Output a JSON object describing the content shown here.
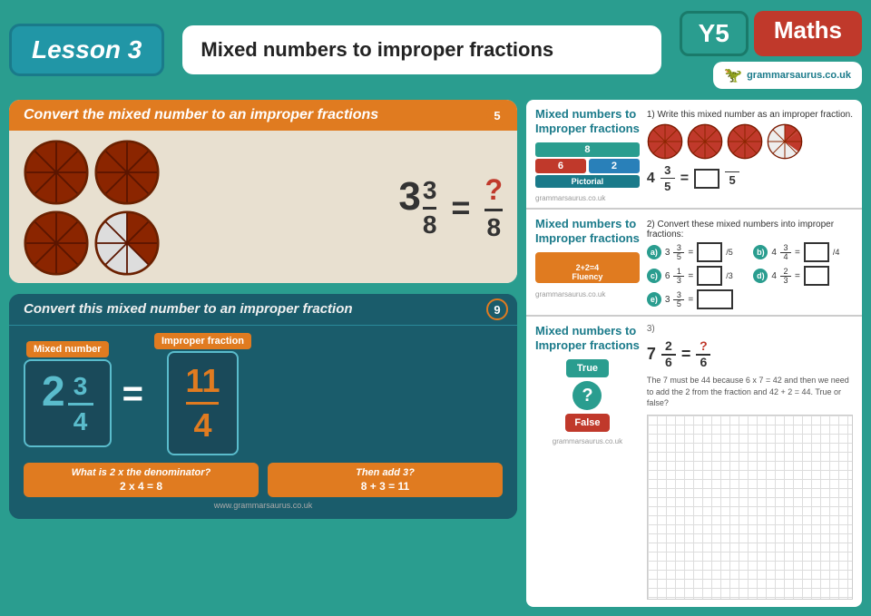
{
  "header": {
    "lesson_label": "Lesson 3",
    "title": "Mixed numbers to improper fractions",
    "year": "Y5",
    "subject": "Maths",
    "branding": "grammarsaurus.co.uk"
  },
  "slide1": {
    "number": "5",
    "header": "Convert the mixed number to an improper fractions",
    "mixed_number": "3",
    "frac_numerator": "3",
    "frac_denominator": "8",
    "equals": "=",
    "answer_numerator": "?",
    "answer_denominator": "8"
  },
  "slide2": {
    "number": "9",
    "header": "Convert this mixed number to an improper fraction",
    "mixed_label": "Mixed number",
    "mixed_whole": "2",
    "mixed_num": "3",
    "mixed_den": "4",
    "equals": "=",
    "improper_label": "Improper fraction",
    "improper_num": "11",
    "improper_den": "4",
    "hint1_question": "What is 2 x the denominator?",
    "hint1_answer": "2 x 4 = 8",
    "hint2_question": "Then add 3?",
    "hint2_answer": "8 + 3 = 11",
    "branding": "www.grammarsaurus.co.uk"
  },
  "worksheet": {
    "section1": {
      "title": "Mixed numbers to\nImproper fractions",
      "instruction": "1) Write this mixed number as an improper fraction.",
      "mixed_whole": "4",
      "mixed_num": "3",
      "mixed_den": "5",
      "equals": "=",
      "answer_den": "5",
      "pictorial_label": "Pictorial",
      "branding": "grammarsaurus.co.uk"
    },
    "section2": {
      "title": "Mixed numbers to\nImproper fractions",
      "instruction": "2) Convert these mixed numbers into improper fractions:",
      "items": [
        {
          "label": "a)",
          "expr": "3 3/5 = __/5"
        },
        {
          "label": "b)",
          "expr": "4 3/4 = __/4"
        },
        {
          "label": "c)",
          "expr": "6 1/3 = __/3"
        },
        {
          "label": "d)",
          "expr": "4 2/3 = __"
        },
        {
          "label": "e)",
          "expr": "3 3/5 = __"
        }
      ],
      "fluency_label": "2+2=4\nFluency",
      "branding": "grammarsaurus.co.uk"
    },
    "section3": {
      "title": "Mixed numbers to\nImproper fractions",
      "question_num": "3)",
      "expression": "7 2/6 = ?/6",
      "explanation": "The 7 must be 44 because 6 x 7 = 42 and then we need to add the 2 from the fraction and 42 + 2 = 44. True or false?",
      "true_label": "True",
      "false_label": "False"
    }
  }
}
